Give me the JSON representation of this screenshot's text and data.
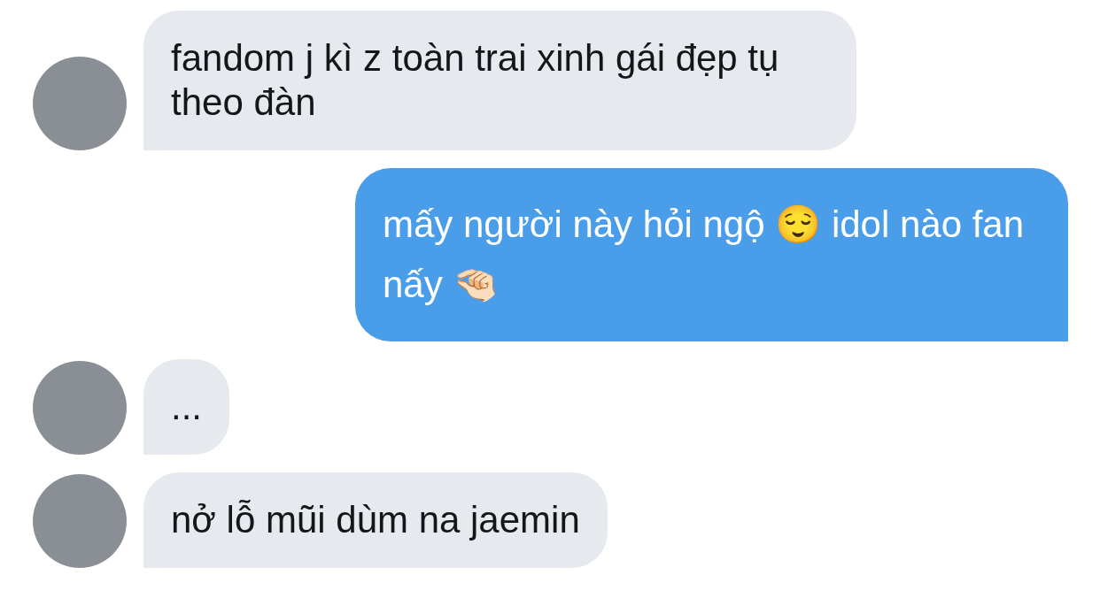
{
  "messages": [
    {
      "kind": "incoming",
      "text": "fandom j kì z toàn trai xinh gái đẹp tụ theo đàn"
    },
    {
      "kind": "outgoing",
      "text": "mấy người này hỏi ngộ 😌 idol nào fan nấy 🤏🏻"
    },
    {
      "kind": "incoming",
      "text": "..."
    },
    {
      "kind": "incoming",
      "text": "nở lỗ mũi dùm na jaemin"
    }
  ]
}
